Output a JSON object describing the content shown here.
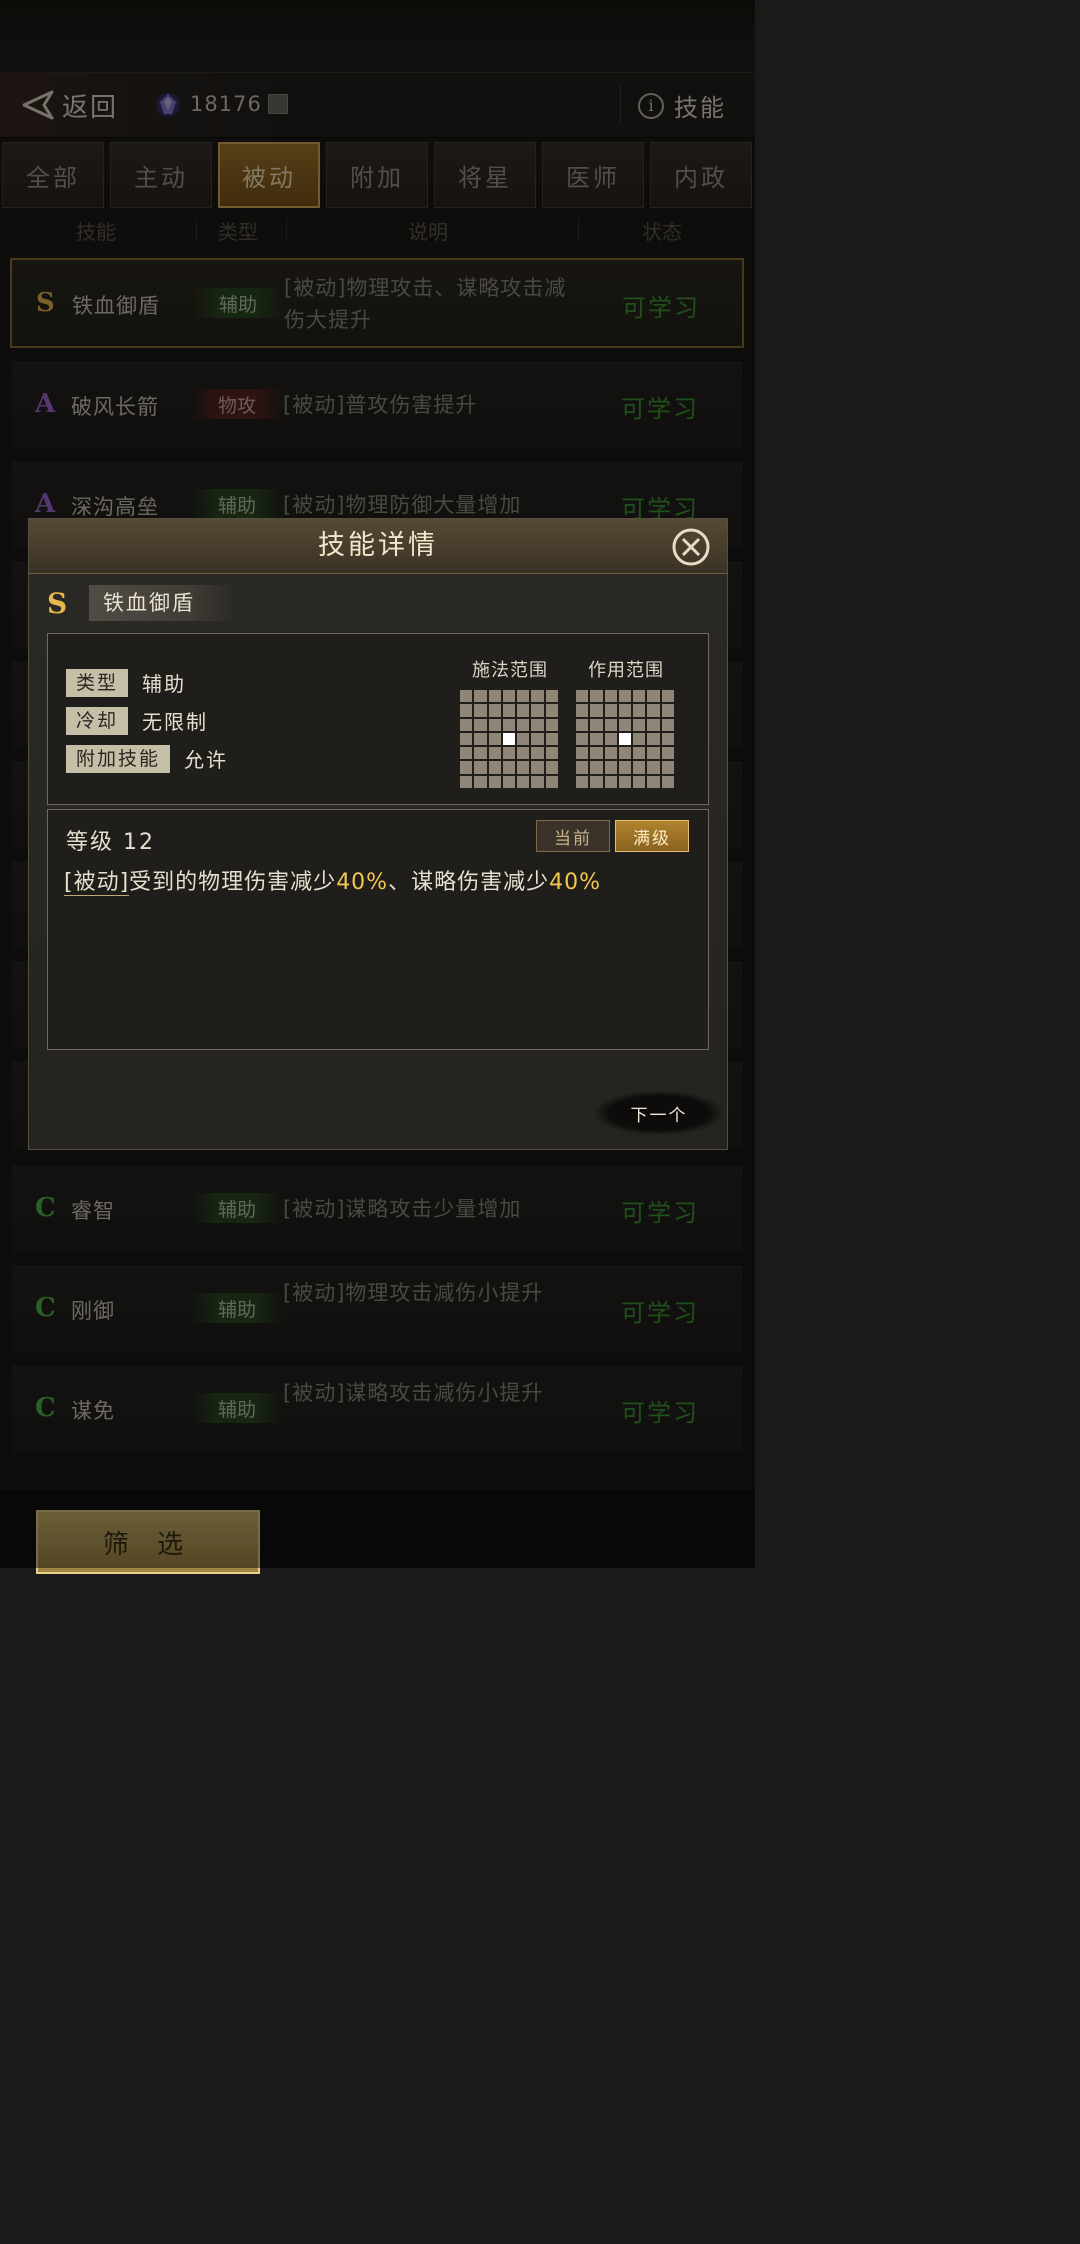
{
  "header": {
    "back_label": "返回",
    "currency_value": "18176",
    "info_label": "技能"
  },
  "tabs": [
    {
      "label": "全部",
      "active": false
    },
    {
      "label": "主动",
      "active": false
    },
    {
      "label": "被动",
      "active": true
    },
    {
      "label": "附加",
      "active": false
    },
    {
      "label": "将星",
      "active": false
    },
    {
      "label": "医师",
      "active": false
    },
    {
      "label": "内政",
      "active": false
    }
  ],
  "columns": {
    "skill": "技能",
    "type": "类型",
    "desc": "说明",
    "status": "状态"
  },
  "skills": [
    {
      "grade": "S",
      "name": "铁血御盾",
      "type": "辅助",
      "desc": "[被动]物理攻击、谋略攻击减伤大提升",
      "status": "可学习"
    },
    {
      "grade": "A",
      "name": "破风长箭",
      "type": "物攻",
      "desc": "[被动]普攻伤害提升",
      "status": "可学习"
    },
    {
      "grade": "A",
      "name": "深沟高垒",
      "type": "辅助",
      "desc": "[被动]物理防御大量增加",
      "status": "可学习"
    },
    {
      "grade": "C",
      "name": "睿智",
      "type": "辅助",
      "desc": "[被动]谋略攻击少量增加",
      "status": "可学习"
    },
    {
      "grade": "C",
      "name": "刚御",
      "type": "辅助",
      "desc": "[被动]物理攻击减伤小提升",
      "status": "可学习"
    },
    {
      "grade": "C",
      "name": "谋免",
      "type": "辅助",
      "desc": "[被动]谋略攻击减伤小提升",
      "status": "可学习"
    }
  ],
  "modal": {
    "title": "技能详情",
    "grade": "S",
    "skill_name": "铁血御盾",
    "type_key": "类型",
    "type_val": "辅助",
    "cd_key": "冷却",
    "cd_val": "无限制",
    "extra_key": "附加技能",
    "extra_val": "允许",
    "cast_range_label": "施法范围",
    "effect_range_label": "作用范围",
    "level_label": "等级 12",
    "btn_current": "当前",
    "btn_max": "满级",
    "desc_tag": "[被动]",
    "desc_a": "受到的物理伤害减少",
    "desc_v1": "40%",
    "desc_b": "、谋略伤害减少",
    "desc_v2": "40%",
    "next_label": "下一个"
  },
  "footer": {
    "filter_label": "筛 选"
  },
  "colors": {
    "accent_gold": "#d9b15a",
    "status_green": "#3f9a33",
    "highlight": "#f2c74e"
  }
}
